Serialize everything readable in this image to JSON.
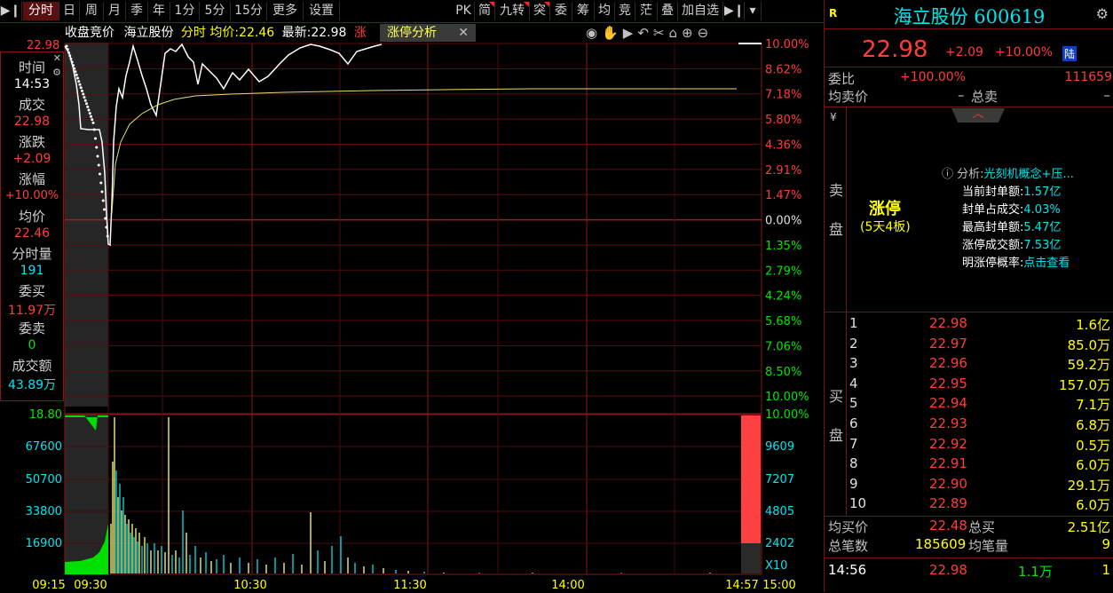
{
  "toolbar": {
    "left_items": [
      "分时",
      "日",
      "周",
      "月",
      "季",
      "年",
      "1分",
      "5分",
      "15分",
      "更多",
      "设置"
    ],
    "right_items": [
      "PK",
      "简",
      "九转",
      "突",
      "委",
      "筹",
      "均",
      "竞",
      "茫",
      "叠",
      "加自选"
    ],
    "flagged_right": [
      1,
      2,
      3
    ],
    "gear": "gear-icon"
  },
  "header": {
    "auction": "收盘竞价",
    "stock_name": "海立股份",
    "view": "分时",
    "avg_label": "均价:",
    "avg_value": "22.46",
    "latest_label": "最新:",
    "latest_value": "22.98",
    "limit_tag": "涨停分析",
    "limit_prefix": "涨",
    "top_price": "22.98"
  },
  "price_axis_left": {
    "top": "22.98"
  },
  "pct_axis": [
    "10.00%",
    "8.62%",
    "7.18%",
    "5.80%",
    "4.36%",
    "2.91%",
    "1.47%",
    "0.00%",
    "1.35%",
    "2.79%",
    "4.24%",
    "5.68%",
    "7.06%",
    "8.50%",
    "10.00%"
  ],
  "vol_axis_left": [
    "18.80",
    "67600",
    "50700",
    "33800",
    "16900"
  ],
  "vol_axis_right": [
    "10.00%",
    "9609",
    "7207",
    "4805",
    "2402",
    "X10"
  ],
  "time_axis": [
    "09:15",
    "09:30",
    "10:30",
    "11:30",
    "14:00",
    "14:57",
    "15:00"
  ],
  "left_panel": {
    "time_label": "时间",
    "time_value": "14:53",
    "deal_label": "成交",
    "deal_value": "22.98",
    "chg_label": "涨跌",
    "chg_value": "+2.09",
    "pct_label": "涨幅",
    "pct_value": "+10.00%",
    "avg_label": "均价",
    "avg_value": "22.46",
    "vol_label": "分时量",
    "vol_value": "191",
    "bid_label": "委买",
    "bid_value": "11.97万",
    "ask_label": "委卖",
    "ask_value": "0",
    "amt_label": "成交额",
    "amt_value": "43.89万"
  },
  "quote": {
    "r_badge": "R",
    "title": "海立股份 600619",
    "price": "22.98",
    "change": "+2.09",
    "pct": "+10.00%",
    "market": "陆",
    "weibi_label": "委比",
    "weibi_value": "+100.00%",
    "weibi_diff": "111659",
    "avg_sell_label": "均卖价",
    "avg_sell_value": "–",
    "total_sell_label": "总卖",
    "total_sell_value": "–",
    "yen": "¥",
    "sell_side_label": [
      "卖",
      "盘"
    ],
    "limit_status": "涨停",
    "limit_boards": "(5天4板)",
    "analysis_label": "分析:",
    "analysis_value": "光刻机概念+压...",
    "stats": [
      {
        "label": "当前封单额:",
        "value": "1.57亿"
      },
      {
        "label": "封单占成交:",
        "value": "4.03%"
      },
      {
        "label": "最高封单额:",
        "value": "5.47亿"
      },
      {
        "label": "涨停成交额:",
        "value": "7.53亿"
      },
      {
        "label": "明涨停概率:",
        "value": "点击查看"
      }
    ],
    "buy_side_label": [
      "买",
      "盘"
    ],
    "bids": [
      {
        "lvl": "1",
        "price": "22.98",
        "vol": "1.6亿"
      },
      {
        "lvl": "2",
        "price": "22.97",
        "vol": "85.0万"
      },
      {
        "lvl": "3",
        "price": "22.96",
        "vol": "59.2万"
      },
      {
        "lvl": "4",
        "price": "22.95",
        "vol": "157.0万"
      },
      {
        "lvl": "5",
        "price": "22.94",
        "vol": "7.1万"
      },
      {
        "lvl": "6",
        "price": "22.93",
        "vol": "6.8万"
      },
      {
        "lvl": "7",
        "price": "22.92",
        "vol": "0.5万"
      },
      {
        "lvl": "8",
        "price": "22.91",
        "vol": "6.0万"
      },
      {
        "lvl": "9",
        "price": "22.90",
        "vol": "29.1万"
      },
      {
        "lvl": "10",
        "price": "22.89",
        "vol": "6.0万"
      }
    ],
    "avg_buy_label": "均买价",
    "avg_buy_value": "22.48",
    "total_buy_label": "总买",
    "total_buy_value": "2.51亿",
    "total_deals_label": "总笔数",
    "total_deals_value": "185609",
    "avg_deal_label": "均笔量",
    "avg_deal_value": "9",
    "tick_time": "14:56",
    "tick_price": "22.98",
    "tick_vol": "1.1万",
    "tick_dir": "1"
  }
}
